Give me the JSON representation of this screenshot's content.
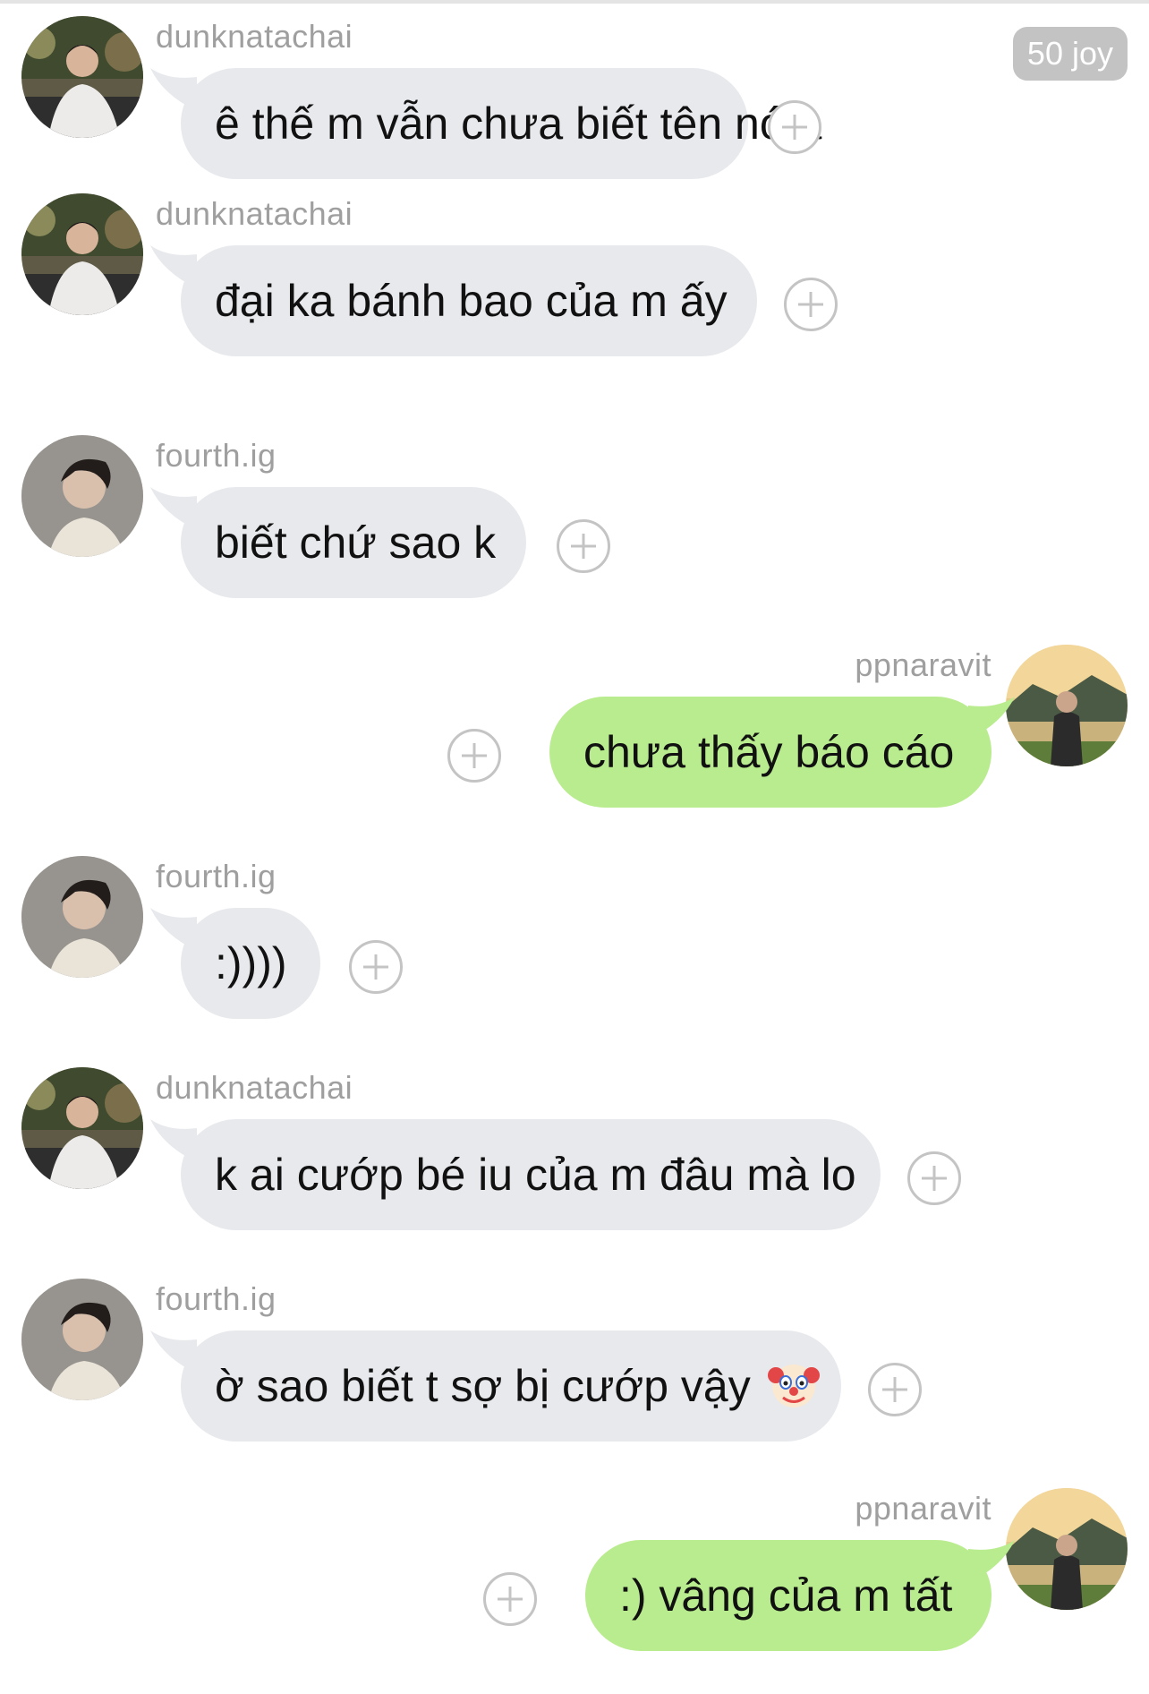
{
  "badge": {
    "label": "50 joy"
  },
  "messages": [
    {
      "sender": "dunknatachai",
      "text": "ê thế m vẫn chưa biết tên nó à",
      "side": "left",
      "avatar": "dunk-avatar"
    },
    {
      "sender": "dunknatachai",
      "text": "đại ka bánh bao của m ấy",
      "side": "left",
      "avatar": "dunk-avatar"
    },
    {
      "sender": "fourth.ig",
      "text": "biết chứ sao k",
      "side": "left",
      "avatar": "fourth-avatar"
    },
    {
      "sender": "ppnaravit",
      "text": "chưa thấy báo cáo",
      "side": "right",
      "avatar": "ppnaravit-avatar"
    },
    {
      "sender": "fourth.ig",
      "text": ":))))",
      "side": "left",
      "avatar": "fourth-avatar"
    },
    {
      "sender": "dunknatachai",
      "text": "k ai cướp bé iu của m đâu mà lo",
      "side": "left",
      "avatar": "dunk-avatar"
    },
    {
      "sender": "fourth.ig",
      "text": "ờ sao biết t sợ bị cướp vậy",
      "side": "left",
      "avatar": "fourth-avatar",
      "emoji": "clown-face-icon"
    },
    {
      "sender": "ppnaravit",
      "text": ":) vâng của m tất",
      "side": "right",
      "avatar": "ppnaravit-avatar"
    }
  ],
  "colors": {
    "incoming_bubble": "#e8e9ed",
    "outgoing_bubble": "#b9ec8e",
    "sender_name": "#9f9f9f",
    "badge_bg": "#c3c3c3"
  }
}
